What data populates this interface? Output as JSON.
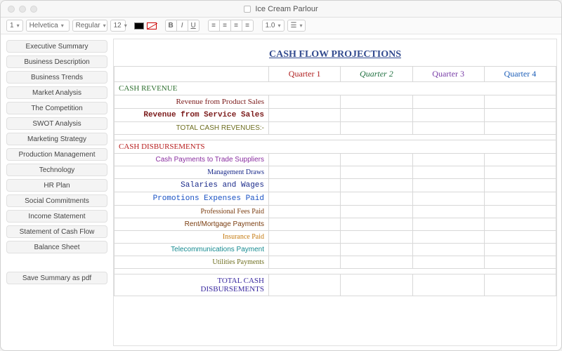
{
  "window": {
    "title": "Ice Cream Parlour"
  },
  "toolbar": {
    "para_style": "1",
    "font_family": "Helvetica",
    "font_style": "Regular",
    "font_size": "12",
    "bold": "B",
    "italic": "I",
    "underline": "U",
    "line_spacing": "1.0"
  },
  "sidebar": {
    "items": [
      "Executive Summary",
      "Business Description",
      "Business Trends",
      "Market Analysis",
      "The Competition",
      "SWOT Analysis",
      "Marketing Strategy",
      "Production Management",
      "Technology",
      "HR Plan",
      "Social Commitments",
      "Income Statement",
      "Statement of Cash Flow",
      "Balance Sheet"
    ],
    "save_pdf": "Save Summary as pdf"
  },
  "doc": {
    "title": "CASH FLOW PROJECTIONS",
    "quarters": {
      "q1": "Quarter 1",
      "q2": "Quarter 2",
      "q3": "Quarter 3",
      "q4": "Quarter 4"
    },
    "sections": {
      "revenue_header": "CASH REVENUE",
      "disb_header": "CASH DISBURSEMENTS",
      "total_disb_1": "TOTAL CASH",
      "total_disb_2": "DISBURSEMENTS"
    },
    "rows": {
      "rev_product": "Revenue from Product Sales",
      "rev_service": "Revenue from Service Sales",
      "rev_total": "TOTAL CASH REVENUES:-",
      "d_trade": "Cash Payments to Trade Suppliers",
      "d_mgmt": "Management Draws",
      "d_salaries": "Salaries and Wages",
      "d_promo": "Promotions Expenses Paid",
      "d_prof": "Professional Fees Paid",
      "d_rent": "Rent/Mortgage Payments",
      "d_ins": "Insurance Paid",
      "d_tele": "Telecommunications Payment",
      "d_util": "Utilities Payments"
    }
  }
}
